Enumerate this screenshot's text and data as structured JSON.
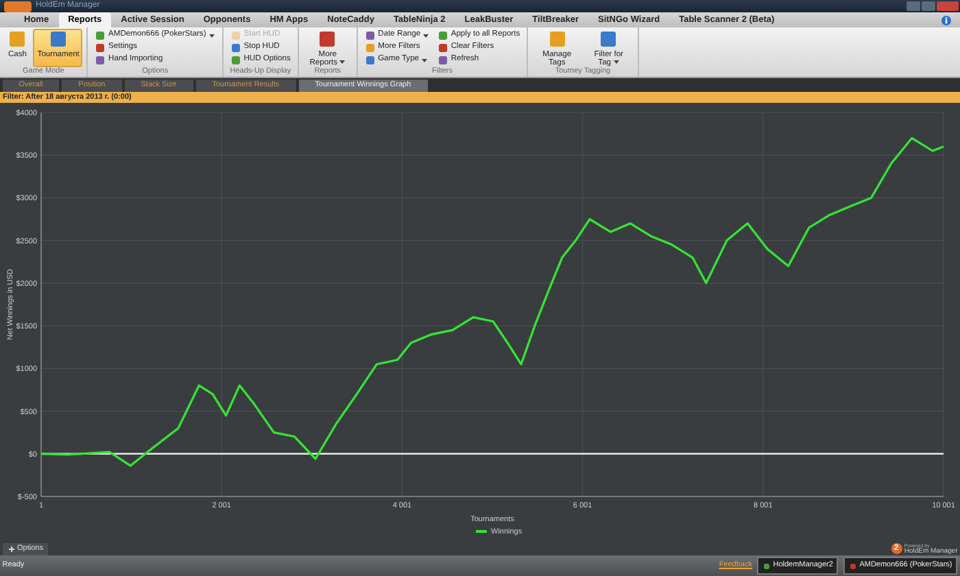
{
  "window": {
    "title": "HoldEm Manager"
  },
  "menu_tabs": [
    {
      "label": "Home",
      "selected": false
    },
    {
      "label": "Reports",
      "selected": true
    },
    {
      "label": "Active Session",
      "selected": false
    },
    {
      "label": "Opponents",
      "selected": false
    },
    {
      "label": "HM Apps",
      "selected": false
    },
    {
      "label": "NoteCaddy",
      "selected": false
    },
    {
      "label": "TableNinja 2",
      "selected": false
    },
    {
      "label": "LeakBuster",
      "selected": false
    },
    {
      "label": "TiltBreaker",
      "selected": false
    },
    {
      "label": "SitNGo Wizard",
      "selected": false
    },
    {
      "label": "Table Scanner 2 (Beta)",
      "selected": false
    }
  ],
  "ribbon_groups": [
    {
      "title": "Game Mode",
      "columns": [
        [
          {
            "label": "Cash",
            "kind": "large",
            "selected": false,
            "disabled": false,
            "dropdown": false
          }
        ],
        [
          {
            "label": "Tournament",
            "kind": "large",
            "selected": true,
            "disabled": false,
            "dropdown": false
          }
        ]
      ]
    },
    {
      "title": "Options",
      "columns": [
        [
          {
            "label": "AMDemon666 (PokerStars)",
            "kind": "small",
            "selected": false,
            "disabled": false,
            "dropdown": true
          },
          {
            "label": "Settings",
            "kind": "small",
            "selected": false,
            "disabled": false,
            "dropdown": false
          },
          {
            "label": "Hand Importing",
            "kind": "small",
            "selected": false,
            "disabled": false,
            "dropdown": false
          }
        ]
      ]
    },
    {
      "title": "Heads-Up Display",
      "columns": [
        [
          {
            "label": "Start HUD",
            "kind": "small",
            "selected": false,
            "disabled": true,
            "dropdown": false
          },
          {
            "label": "Stop HUD",
            "kind": "small",
            "selected": false,
            "disabled": false,
            "dropdown": false
          },
          {
            "label": "HUD Options",
            "kind": "small",
            "selected": false,
            "disabled": false,
            "dropdown": false
          }
        ]
      ]
    },
    {
      "title": "Reports",
      "columns": [
        [
          {
            "label": "More Reports",
            "kind": "large",
            "selected": false,
            "disabled": false,
            "dropdown": true
          }
        ]
      ]
    },
    {
      "title": "Filters",
      "columns": [
        [
          {
            "label": "Date Range",
            "kind": "small",
            "selected": false,
            "disabled": false,
            "dropdown": true
          },
          {
            "label": "More Filters",
            "kind": "small",
            "selected": false,
            "disabled": false,
            "dropdown": false
          },
          {
            "label": "Game Type",
            "kind": "small",
            "selected": false,
            "disabled": false,
            "dropdown": true
          }
        ],
        [
          {
            "label": "Apply to all Reports",
            "kind": "small",
            "selected": false,
            "disabled": false,
            "dropdown": false
          },
          {
            "label": "Clear Filters",
            "kind": "small",
            "selected": false,
            "disabled": false,
            "dropdown": false
          },
          {
            "label": "Refresh",
            "kind": "small",
            "selected": false,
            "disabled": false,
            "dropdown": false
          }
        ]
      ]
    },
    {
      "title": "Tourney Tagging",
      "columns": [
        [
          {
            "label": "Manage Tags",
            "kind": "large",
            "selected": false,
            "disabled": false,
            "dropdown": false
          }
        ],
        [
          {
            "label": "Filter for Tag",
            "kind": "large",
            "selected": false,
            "disabled": false,
            "dropdown": true
          }
        ]
      ]
    }
  ],
  "doc_tabs": [
    {
      "label": "Overall",
      "selected": false
    },
    {
      "label": "Position",
      "selected": false
    },
    {
      "label": "Stack Size",
      "selected": false
    },
    {
      "label": "Tournament Results",
      "selected": false
    },
    {
      "label": "Tournament Winnings Graph",
      "selected": true
    }
  ],
  "filter_bar": "Filter: After 18 августа 2013 г. (0:00)",
  "graph": {
    "chart_data": {
      "type": "line",
      "grid": true,
      "xlabel": "Tournaments",
      "ylabel": "Net Winnings in USD",
      "xlim": [
        1,
        10001
      ],
      "ylim": [
        -500,
        4000
      ],
      "xticks": [
        {
          "value": 1,
          "label": "1"
        },
        {
          "value": 2001,
          "label": "2 001"
        },
        {
          "value": 4001,
          "label": "4 001"
        },
        {
          "value": 6001,
          "label": "6 001"
        },
        {
          "value": 8001,
          "label": "8 001"
        },
        {
          "value": 10001,
          "label": "10 001"
        }
      ],
      "yticks": [
        {
          "value": -500,
          "label": "$-500"
        },
        {
          "value": 0,
          "label": "$0"
        },
        {
          "value": 500,
          "label": "$500"
        },
        {
          "value": 1000,
          "label": "$1000"
        },
        {
          "value": 1500,
          "label": "$1500"
        },
        {
          "value": 2000,
          "label": "$2000"
        },
        {
          "value": 2500,
          "label": "$2500"
        },
        {
          "value": 3000,
          "label": "$3000"
        },
        {
          "value": 3500,
          "label": "$3500"
        },
        {
          "value": 4000,
          "label": "$4000"
        }
      ],
      "x": [
        1,
        300,
        760,
        990,
        1215,
        1520,
        1750,
        1900,
        2050,
        2200,
        2350,
        2580,
        2810,
        3040,
        3270,
        3500,
        3720,
        3950,
        4100,
        4330,
        4560,
        4790,
        5010,
        5170,
        5320,
        5470,
        5620,
        5775,
        5925,
        6080,
        6310,
        6530,
        6760,
        6990,
        7220,
        7370,
        7600,
        7830,
        8050,
        8280,
        8510,
        8740,
        8970,
        9200,
        9420,
        9650,
        9880,
        10001
      ],
      "series": [
        {
          "name": "Winnings",
          "color": "#33e633",
          "values": [
            0,
            -10,
            20,
            -140,
            50,
            300,
            800,
            700,
            450,
            800,
            600,
            250,
            200,
            -60,
            350,
            700,
            1050,
            1100,
            1300,
            1400,
            1450,
            1600,
            1550,
            1300,
            1050,
            1500,
            1900,
            2300,
            2500,
            2750,
            2600,
            2700,
            2550,
            2450,
            2300,
            2000,
            2500,
            2700,
            2400,
            2200,
            2650,
            2800,
            2900,
            3000,
            3400,
            3700,
            3550,
            3600
          ]
        }
      ]
    }
  },
  "options_panel": {
    "label": "Options",
    "expanded": false
  },
  "logo": {
    "badge": "2",
    "caption": "Powered by",
    "name": "HoldEm Manager"
  },
  "status_bar": {
    "status": "Ready",
    "link": "Feedback",
    "items": [
      "HoldemManager2",
      "AMDemon666 (PokerStars)"
    ]
  }
}
